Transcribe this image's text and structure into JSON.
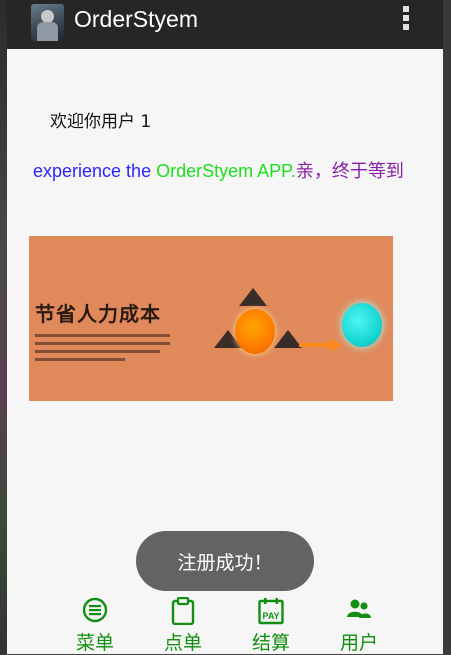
{
  "appbar": {
    "title": "OrderStyem",
    "app_icon": "app-avatar-icon",
    "menu_icon": "overflow-menu-icon"
  },
  "main": {
    "welcome_text": "欢迎你用户  1",
    "marquee": {
      "part1": "experience the ",
      "part2": "OrderStyem APP.",
      "part3": "亲，终于等到"
    },
    "banner": {
      "headline": "节省人力成本"
    }
  },
  "toast": {
    "text": "注册成功！"
  },
  "nav": {
    "items": [
      {
        "label": "菜单",
        "icon": "menu-list-icon"
      },
      {
        "label": "点单",
        "icon": "clipboard-icon"
      },
      {
        "label": "结算",
        "icon": "pay-calendar-icon"
      },
      {
        "label": "用户",
        "icon": "users-icon"
      }
    ]
  },
  "colors": {
    "accent_green": "#128f12",
    "marquee_blue": "#2a24ff",
    "marquee_green": "#1bdf1b",
    "marquee_purple": "#8a1ea8",
    "appbar_bg": "#262626",
    "banner_bg": "#e08a5c"
  }
}
